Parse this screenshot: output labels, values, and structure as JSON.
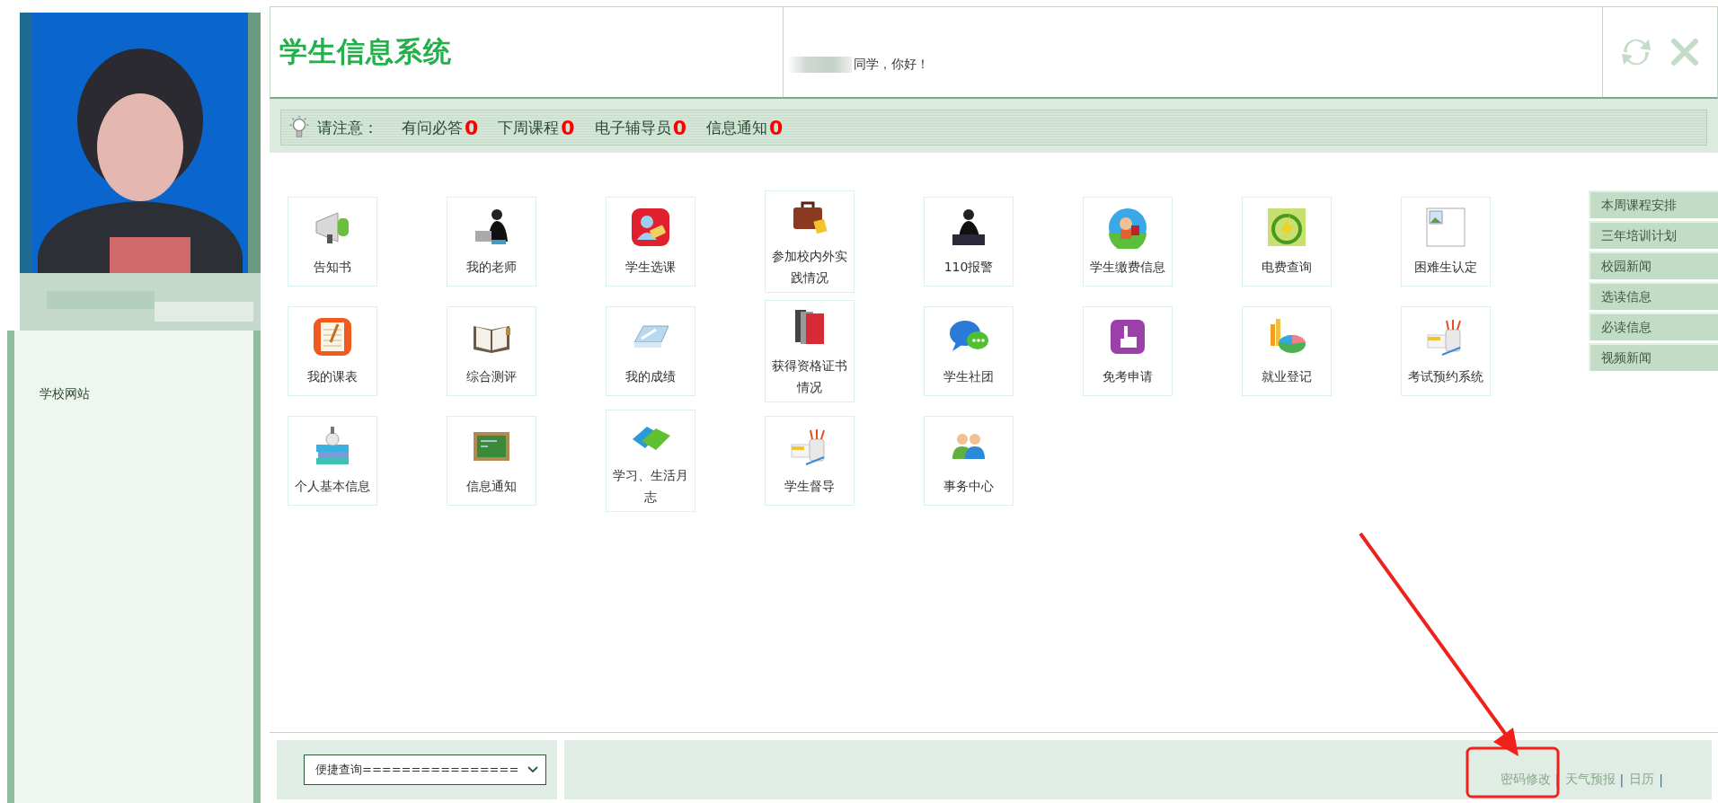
{
  "sidebar": {
    "links": [
      "学校网站"
    ]
  },
  "header": {
    "title": "学生信息系统",
    "greeting": "同学，你好！"
  },
  "notice": {
    "label": "请注意：",
    "items": [
      {
        "label": "有问必答",
        "count": "0"
      },
      {
        "label": "下周课程",
        "count": "0"
      },
      {
        "label": "电子辅导员",
        "count": "0"
      },
      {
        "label": "信息通知",
        "count": "0"
      }
    ]
  },
  "tiles": [
    {
      "label": "告知书"
    },
    {
      "label": "我的老师"
    },
    {
      "label": "学生选课"
    },
    {
      "label": "参加校内外实践情况"
    },
    {
      "label": "110报警"
    },
    {
      "label": "学生缴费信息"
    },
    {
      "label": "电费查询"
    },
    {
      "label": "困难生认定"
    },
    {
      "label": "我的课表"
    },
    {
      "label": "综合测评"
    },
    {
      "label": "我的成绩"
    },
    {
      "label": "获得资格证书情况"
    },
    {
      "label": "学生社团"
    },
    {
      "label": "免考申请"
    },
    {
      "label": "就业登记"
    },
    {
      "label": "考试预约系统"
    },
    {
      "label": "个人基本信息"
    },
    {
      "label": "信息通知"
    },
    {
      "label": "学习、生活月志"
    },
    {
      "label": "学生督导"
    },
    {
      "label": "事务中心"
    }
  ],
  "side_tabs": [
    "本周课程安排",
    "三年培训计划",
    "校园新闻",
    "选读信息",
    "必读信息",
    "视频新闻"
  ],
  "footer": {
    "select": {
      "value": "便捷查询================"
    },
    "links": [
      "密码修改",
      "天气预报",
      "日历"
    ],
    "separator": "|"
  }
}
